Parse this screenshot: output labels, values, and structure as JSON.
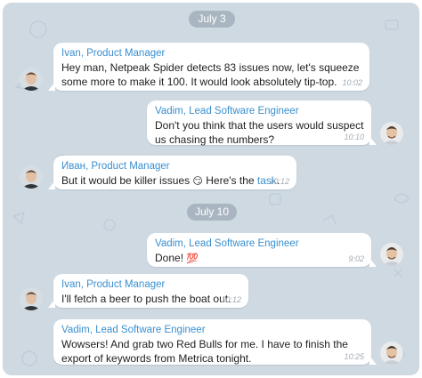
{
  "dates": [
    "July 3",
    "July 10"
  ],
  "messages": [
    {
      "sender": "Ivan, Product Manager",
      "text": "Hey man, Netpeak Spider detects 83 issues now, let's squeeze some more to make it 100. It would look absolutely tip-top.",
      "time": "10:02"
    },
    {
      "sender": "Vadim, Lead Software Engineer",
      "text": "Don't you think that the users would suspect us chasing the numbers?",
      "time": "10:10"
    },
    {
      "sender": "Иван, Product Manager",
      "text": "But it would be killer issues",
      "emoji": "😏",
      "text2": "Here's the",
      "link": "task",
      "text3": ".",
      "time": "10:12"
    },
    {
      "sender": "Vadim, Lead Software Engineer",
      "text": "Done!",
      "emoji": "💯",
      "time": "9:02"
    },
    {
      "sender": "Ivan, Product Manager",
      "text": "I'll fetch a beer to push the boat out.",
      "time": "10:12"
    },
    {
      "sender": "Vadim, Lead Software Engineer",
      "text": "Wowsers! And grab two Red Bulls for me. I have to finish the export of keywords from Metrica tonight.",
      "time": "10:25"
    }
  ],
  "colors": {
    "background": "#cfd9e2",
    "bubble": "#ffffff",
    "sender": "#3a8fcf",
    "link": "#3a8fcf",
    "date_pill": "#a9b6c1",
    "timestamp": "#a3adb6"
  },
  "icons": [
    "ivan-avatar",
    "vadim-avatar",
    "hundred-points-emoji",
    "smirk-emoji"
  ]
}
